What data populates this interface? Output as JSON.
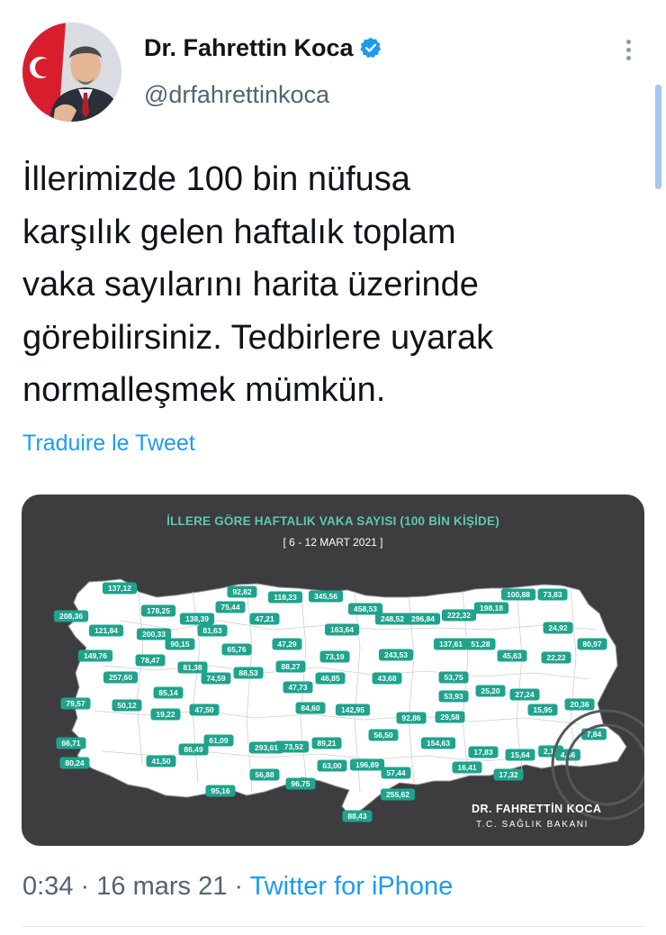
{
  "author": {
    "display_name": "Dr. Fahrettin Koca",
    "handle": "@drfahrettinkoca",
    "verified_icon": "verified-badge-icon",
    "accent": "#1d9bf0"
  },
  "tweet": {
    "text": "İllerimizde 100 bin nüfusa\nkarşılık gelen haftalık toplam\nvaka sayılarını harita üzerinde\ngörebilirsiniz. Tedbirlere uyarak\nnormalleşmek mümkün.",
    "translate_label": "Traduire le Tweet",
    "time": "0:34",
    "date": "16 mars 21",
    "source": "Twitter for iPhone",
    "sep": "·"
  },
  "map": {
    "title": "İLLERE GÖRE HAFTALIK VAKA SAYISI (100 BİN KİŞİDE)",
    "date_range": "[ 6 - 12 MART 2021 ]",
    "signature_name": "DR. FAHRETTİN KOCA",
    "signature_title": "T.C. SAĞLIK BAKANI",
    "background": "#3d3d3f",
    "badge_color": "#1fa38c",
    "values": [
      "137,12",
      "178,25",
      "92,82",
      "118,23",
      "345,56",
      "458,53",
      "100,88",
      "73,83",
      "208,36",
      "138,39",
      "75,44",
      "47,21",
      "198,18",
      "222,32",
      "121,84",
      "200,33",
      "81,63",
      "163,64",
      "248,52",
      "296,84",
      "24,92",
      "90,15",
      "65,76",
      "47,29",
      "137,61",
      "51,28",
      "80,97",
      "149,76",
      "78,47",
      "81,38",
      "88,53",
      "88,27",
      "73,19",
      "243,53",
      "45,63",
      "22,22",
      "257,60",
      "74,59",
      "46,85",
      "43,68",
      "53,75",
      "85,14",
      "47,73",
      "53,93",
      "25,20",
      "27,24",
      "79,57",
      "50,12",
      "47,50",
      "84,60",
      "142,95",
      "92,86",
      "29,58",
      "15,95",
      "20,36",
      "19,22",
      "173,52",
      "56,50",
      "17,83",
      "15,64",
      "2,11",
      "66,71",
      "61,09",
      "293,61",
      "89,21",
      "154,63",
      "41,50",
      "86,49",
      "196,89",
      "57,44",
      "16,41",
      "4,46",
      "7,84",
      "80,24",
      "56,88",
      "63,00",
      "17,32",
      "96,75",
      "95,16",
      "255,62",
      "88,43"
    ]
  }
}
